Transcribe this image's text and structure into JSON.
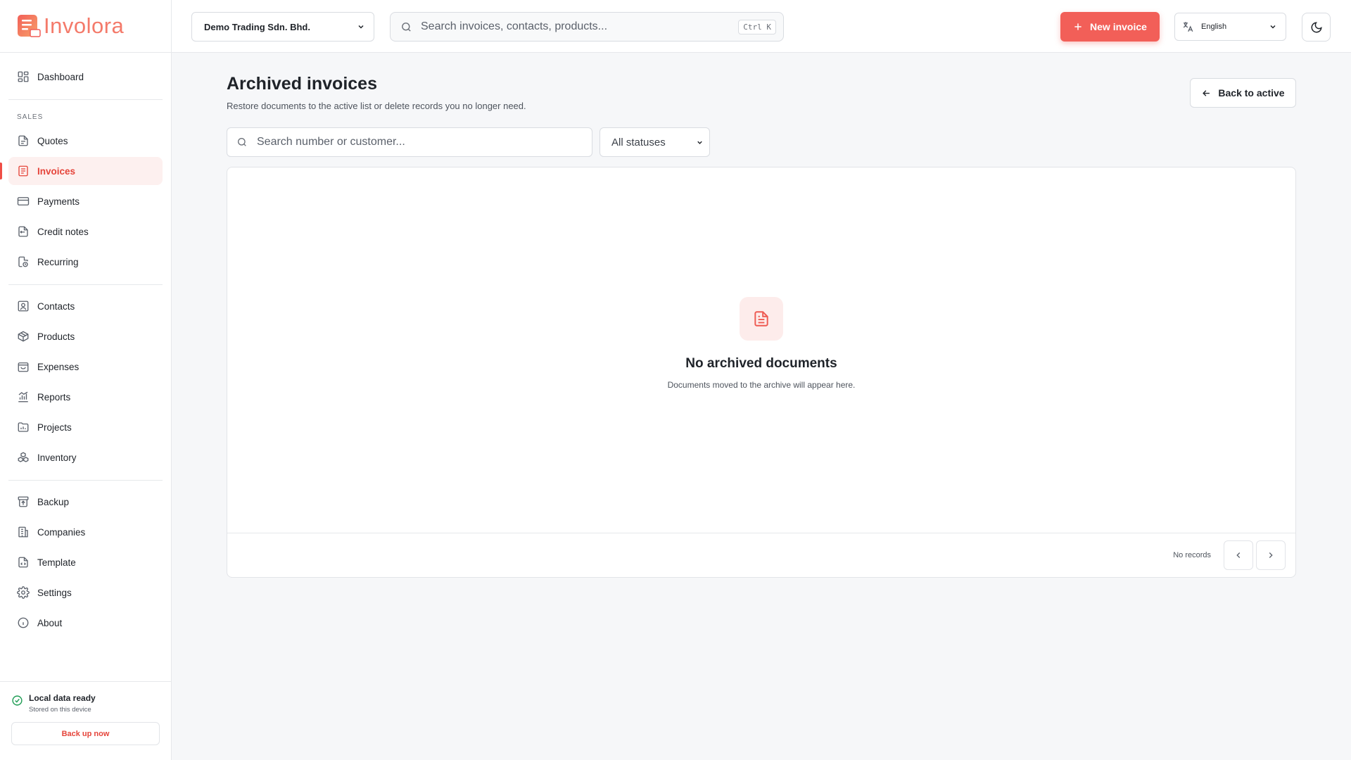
{
  "brand": {
    "name": "Involora",
    "accent": "#f25f58"
  },
  "sidebar": {
    "dashboard": {
      "label": "Dashboard",
      "icon": "dashboard-icon"
    },
    "section_sales": "SALES",
    "sales": [
      {
        "label": "Quotes",
        "icon": "quote-icon"
      },
      {
        "label": "Invoices",
        "icon": "invoice-icon",
        "active": true
      },
      {
        "label": "Payments",
        "icon": "card-icon"
      },
      {
        "label": "Credit notes",
        "icon": "credit-note-icon"
      },
      {
        "label": "Recurring",
        "icon": "recurring-icon"
      }
    ],
    "main": [
      {
        "label": "Contacts",
        "icon": "contacts-icon"
      },
      {
        "label": "Products",
        "icon": "box-icon"
      },
      {
        "label": "Expenses",
        "icon": "wallet-icon"
      },
      {
        "label": "Reports",
        "icon": "chart-icon"
      },
      {
        "label": "Projects",
        "icon": "folder-icon"
      },
      {
        "label": "Inventory",
        "icon": "boxes-icon"
      }
    ],
    "system": [
      {
        "label": "Backup",
        "icon": "archive-icon"
      },
      {
        "label": "Companies",
        "icon": "building-icon"
      },
      {
        "label": "Template",
        "icon": "template-icon"
      },
      {
        "label": "Settings",
        "icon": "gear-icon"
      },
      {
        "label": "About",
        "icon": "info-icon"
      }
    ],
    "footer": {
      "status_title": "Local data ready",
      "status_sub": "Stored on this device",
      "backup_label": "Back up now"
    }
  },
  "topbar": {
    "company": "Demo Trading Sdn. Bhd.",
    "search_placeholder": "Search invoices, contacts, products...",
    "shortcut": "Ctrl K",
    "new_invoice_label": "New invoice",
    "language": "English"
  },
  "page": {
    "title": "Archived invoices",
    "subtitle": "Restore documents to the active list or delete records you no longer need.",
    "back_label": "Back to active",
    "filter_placeholder": "Search number or customer...",
    "status_filter": "All statuses",
    "empty_title": "No archived documents",
    "empty_sub": "Documents moved to the archive will appear here.",
    "records_label": "No records"
  }
}
